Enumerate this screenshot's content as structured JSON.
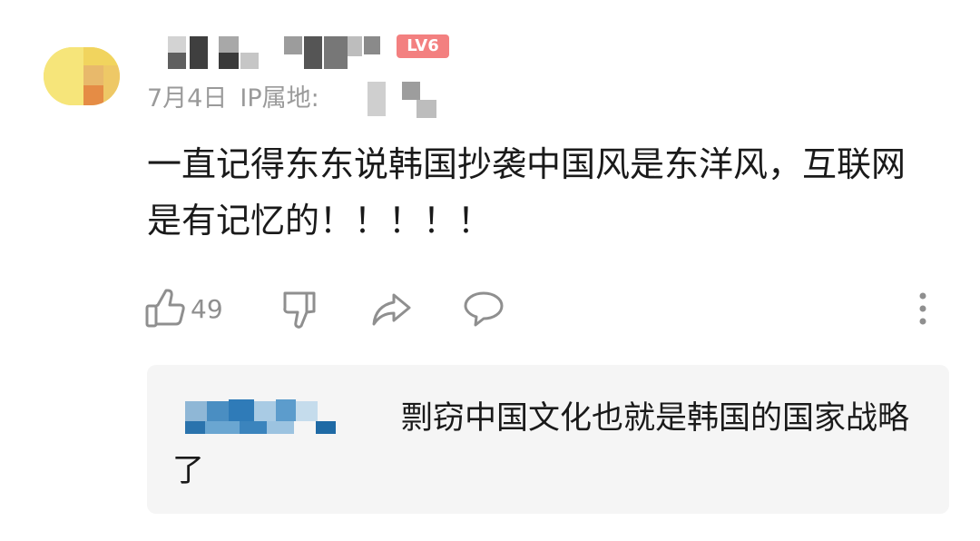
{
  "comment": {
    "date": "7月4日",
    "ip_label": "IP属地:",
    "level": "LV6",
    "body": "一直记得东东说韩国抄袭中国风是东洋风，互联网是有记忆的！！！！！",
    "likes": "49"
  },
  "reply": {
    "body": "剽窃中国文化也就是韩国的国家战略了"
  },
  "icons": {
    "like": "thumbs-up-icon",
    "dislike": "thumbs-down-icon",
    "share": "share-icon",
    "reply": "comment-bubble-icon",
    "more": "more-vertical-icon"
  },
  "colors": {
    "level_badge": "#f26a6a",
    "meta_text": "#9a9a9a",
    "reply_bg": "#f5f5f5"
  }
}
